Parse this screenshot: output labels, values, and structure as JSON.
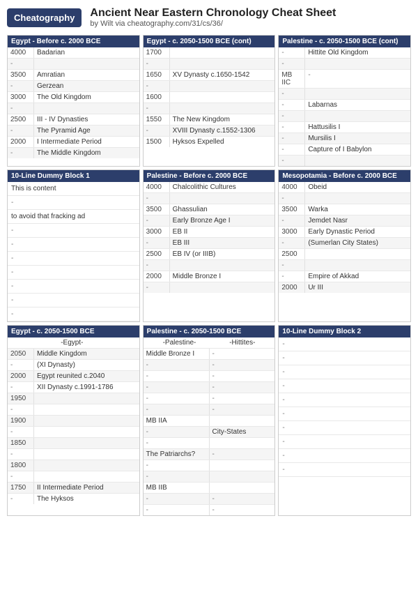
{
  "header": {
    "logo": "Cheatography",
    "title": "Ancient Near Eastern Chronology Cheat Sheet",
    "subtitle": "by Wilt via cheatography.com/31/cs/36/"
  },
  "sections": {
    "egypt_before_2000": {
      "title": "Egypt - Before c. 2000 BCE",
      "rows": [
        {
          "year": "4000",
          "content": "Badarian"
        },
        {
          "year": "-",
          "content": ""
        },
        {
          "year": "3500",
          "content": "Amratian"
        },
        {
          "year": "-",
          "content": "Gerzean"
        },
        {
          "year": "3000",
          "content": "The Old Kingdom"
        },
        {
          "year": "-",
          "content": ""
        },
        {
          "year": "2500",
          "content": "III - IV Dynasties"
        },
        {
          "year": "-",
          "content": "The Pyramid Age"
        },
        {
          "year": "2000",
          "content": "I Intermediate Period"
        },
        {
          "year": "-",
          "content": "The Middle Kingdom"
        }
      ]
    },
    "dummy_block_1": {
      "title": "10-Line Dummy Block 1",
      "content_lines": [
        "This is content",
        "-",
        "to avoid that fracking ad",
        "-",
        "-",
        "-",
        "-",
        "-",
        "-",
        "-"
      ]
    },
    "egypt_2050_1500": {
      "title": "Egypt - c. 2050-1500 BCE",
      "rows": [
        {
          "year": "-",
          "content": "Egypt-",
          "indent": true
        },
        {
          "year": "2050",
          "content": "Middle Kingdom"
        },
        {
          "year": "-",
          "content": "(XI Dynasty)"
        },
        {
          "year": "2000",
          "content": "Egypt reunited c.2040"
        },
        {
          "year": "-",
          "content": "XII Dynasty c.1991-1786"
        },
        {
          "year": "1950",
          "content": ""
        },
        {
          "year": "-",
          "content": ""
        },
        {
          "year": "1900",
          "content": ""
        },
        {
          "year": "-",
          "content": ""
        },
        {
          "year": "1850",
          "content": ""
        },
        {
          "year": "-",
          "content": ""
        },
        {
          "year": "1800",
          "content": ""
        },
        {
          "year": "-",
          "content": ""
        },
        {
          "year": "1750",
          "content": "II Intermediate Period"
        },
        {
          "year": "-",
          "content": "The Hyksos"
        }
      ]
    },
    "egypt_cont": {
      "title": "Egypt - c. 2050-1500 BCE (cont)",
      "rows": [
        {
          "year": "1700",
          "content": ""
        },
        {
          "year": "-",
          "content": ""
        },
        {
          "year": "1650",
          "content": "XV Dynasty c.1650-1542"
        },
        {
          "year": "-",
          "content": ""
        },
        {
          "year": "1600",
          "content": ""
        },
        {
          "year": "-",
          "content": ""
        },
        {
          "year": "1550",
          "content": "The New Kingdom"
        },
        {
          "year": "-",
          "content": "XVIII Dynasty c.1552-1306"
        },
        {
          "year": "1500",
          "content": "Hyksos Expelled"
        }
      ]
    },
    "palestine_before_2000": {
      "title": "Palestine - Before c. 2000 BCE",
      "rows": [
        {
          "year": "4000",
          "content": "Chalcolithic Cultures"
        },
        {
          "year": "-",
          "content": ""
        },
        {
          "year": "3500",
          "content": "Ghassulian"
        },
        {
          "year": "-",
          "content": "Early Bronze Age I"
        },
        {
          "year": "3000",
          "content": "EB II"
        },
        {
          "year": "-",
          "content": "EB III"
        },
        {
          "year": "2500",
          "content": "EB IV (or IIIB)"
        },
        {
          "year": "-",
          "content": ""
        },
        {
          "year": "2000",
          "content": "Middle Bronze I"
        },
        {
          "year": "-",
          "content": ""
        }
      ]
    },
    "palestine_2050_1500": {
      "title": "Palestine - c. 2050-1500 BCE",
      "header_cols": [
        "-Palestine-",
        "-Hittites-"
      ],
      "rows": [
        {
          "col_a": "Middle Bronze I",
          "col_b": "-"
        },
        {
          "col_a": "-",
          "col_b": "-"
        },
        {
          "col_a": "-",
          "col_b": "-"
        },
        {
          "col_a": "-",
          "col_b": "-"
        },
        {
          "col_a": "-",
          "col_b": "-"
        },
        {
          "col_a": "-",
          "col_b": "-"
        },
        {
          "col_a": "MB IIA",
          "col_b": ""
        },
        {
          "col_a": "-",
          "col_b": "City-States"
        },
        {
          "col_a": "-",
          "col_b": ""
        },
        {
          "col_a": "The Patriarchs?",
          "col_b": "-"
        },
        {
          "col_a": "-",
          "col_b": ""
        },
        {
          "col_a": "-",
          "col_b": ""
        },
        {
          "col_a": "MB IIB",
          "col_b": ""
        },
        {
          "col_a": "-",
          "col_b": "-"
        },
        {
          "col_a": "-",
          "col_b": "-"
        }
      ]
    },
    "palestine_cont": {
      "title": "Palestine - c. 2050-1500 BCE (cont)",
      "rows": [
        {
          "year": "-",
          "content": "Hittite Old Kingdom"
        },
        {
          "year": "-",
          "content": ""
        },
        {
          "year": "MB IIC",
          "content": "-"
        },
        {
          "year": "-",
          "content": ""
        },
        {
          "year": "-",
          "content": "Labarnas"
        },
        {
          "year": "-",
          "content": ""
        },
        {
          "year": "-",
          "content": "Hattusilis I"
        },
        {
          "year": "-",
          "content": "Mursilis I"
        },
        {
          "year": "-",
          "content": "Capture of I Babylon"
        },
        {
          "year": "-",
          "content": ""
        }
      ]
    },
    "mesopotamia_before_2000": {
      "title": "Mesopotamia - Before c. 2000 BCE",
      "rows": [
        {
          "year": "4000",
          "content": "Obeid"
        },
        {
          "year": "-",
          "content": ""
        },
        {
          "year": "3500",
          "content": "Warka"
        },
        {
          "year": "-",
          "content": "Jemdet Nasr"
        },
        {
          "year": "3000",
          "content": "Early Dynastic Period"
        },
        {
          "year": "-",
          "content": "(Sumerlan City States)"
        },
        {
          "year": "2500",
          "content": ""
        },
        {
          "year": "-",
          "content": ""
        },
        {
          "year": "-",
          "content": "Empire of Akkad"
        },
        {
          "year": "2000",
          "content": "Ur III"
        }
      ]
    },
    "dummy_block_2": {
      "title": "10-Line Dummy Block 2",
      "rows": [
        "-",
        "-",
        "-",
        "-",
        "-",
        "-",
        "-",
        "-",
        "-",
        "-"
      ]
    }
  }
}
